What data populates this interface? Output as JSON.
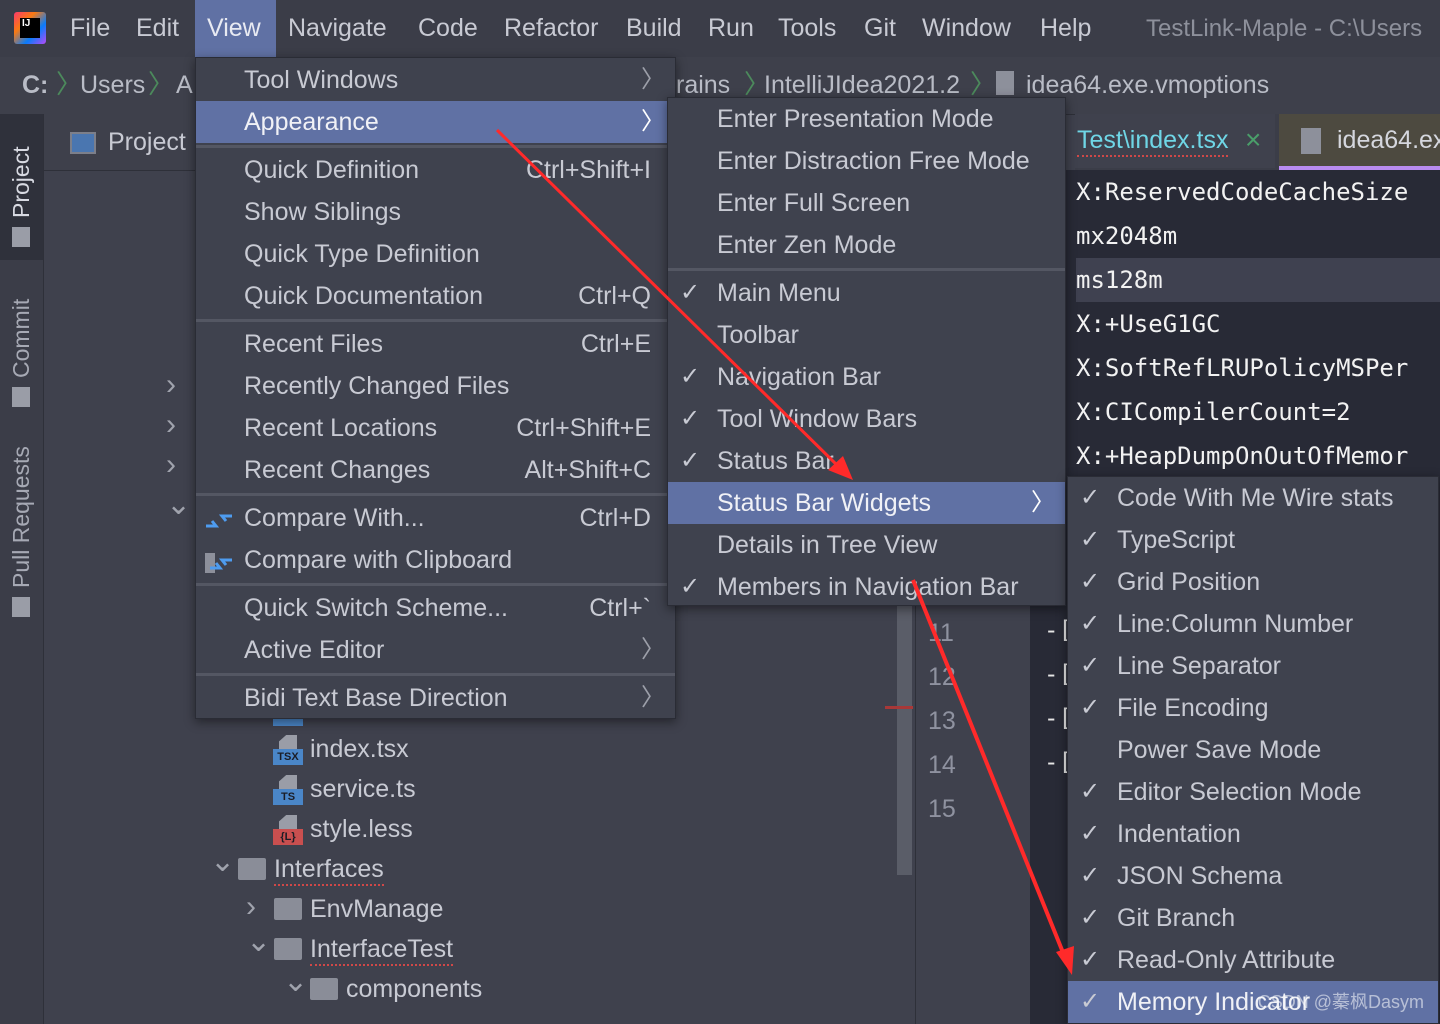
{
  "app": {
    "logo_text": "IJ",
    "title": "TestLink-Maple - C:\\Users"
  },
  "menubar": [
    "File",
    "Edit",
    "View",
    "Navigate",
    "Code",
    "Refactor",
    "Build",
    "Run",
    "Tools",
    "Git",
    "Window",
    "Help"
  ],
  "menubar_active": "View",
  "breadcrumb": [
    "C:",
    "Users",
    "A",
    "rains",
    "IntelliJIdea2021.2",
    "idea64.exe.vmoptions"
  ],
  "tool_strip": [
    {
      "label": "Project",
      "icon": "folder-icon",
      "active": true
    },
    {
      "label": "Commit",
      "icon": "commit-icon"
    },
    {
      "label": "Pull Requests",
      "icon": "pull-request-icon"
    }
  ],
  "project_panel": {
    "title": "Project"
  },
  "tree": [
    {
      "label": "index.tsx",
      "type": "file",
      "badge": "TSX",
      "badge_color": "#4a86c8"
    },
    {
      "label": "service.ts",
      "type": "file",
      "badge": "TS",
      "badge_color": "#4a86c8"
    },
    {
      "label": "style.less",
      "type": "file",
      "badge": "{L}",
      "badge_color": "#c94f4f"
    },
    {
      "label": "Interfaces",
      "type": "folder",
      "expanded": true
    },
    {
      "label": "EnvManage",
      "type": "folder",
      "expanded": false
    },
    {
      "label": "InterfaceTest",
      "type": "folder",
      "expanded": true
    },
    {
      "label": "components",
      "type": "folder",
      "expanded": true
    }
  ],
  "editor": {
    "tabs": [
      {
        "label": "Test\\index.tsx",
        "active": false,
        "close": "×"
      },
      {
        "label": "idea64.ex",
        "active": true
      }
    ],
    "lines": [
      "X:ReservedCodeCacheSize",
      "mx2048m",
      "ms128m",
      "X:+UseG1GC",
      "X:SoftRefLRUPolicyMSPer",
      "X:CICompilerCount=2",
      "X:+HeapDumpOnOutOfMemor"
    ],
    "highlighted_line": 2,
    "line_numbers": [
      "11",
      "12",
      "13",
      "14",
      "15"
    ],
    "fold_marker": "-["
  },
  "view_menu": [
    {
      "label": "Tool Windows",
      "submenu": true
    },
    {
      "label": "Appearance",
      "submenu": true,
      "selected": true
    },
    {
      "sep": true
    },
    {
      "label": "Quick Definition",
      "shortcut": "Ctrl+Shift+I"
    },
    {
      "label": "Show Siblings"
    },
    {
      "label": "Quick Type Definition"
    },
    {
      "label": "Quick Documentation",
      "shortcut": "Ctrl+Q"
    },
    {
      "sep": true
    },
    {
      "label": "Recent Files",
      "shortcut": "Ctrl+E"
    },
    {
      "label": "Recently Changed Files"
    },
    {
      "label": "Recent Locations",
      "shortcut": "Ctrl+Shift+E"
    },
    {
      "label": "Recent Changes",
      "shortcut": "Alt+Shift+C"
    },
    {
      "sep": true
    },
    {
      "label": "Compare With...",
      "shortcut": "Ctrl+D",
      "icon": "compare-icon"
    },
    {
      "label": "Compare with Clipboard",
      "icon": "compare-clipboard-icon"
    },
    {
      "sep": true
    },
    {
      "label": "Quick Switch Scheme...",
      "shortcut": "Ctrl+`"
    },
    {
      "label": "Active Editor",
      "submenu": true
    },
    {
      "sep": true
    },
    {
      "label": "Bidi Text Base Direction",
      "submenu": true
    }
  ],
  "appearance_menu": [
    {
      "label": "Enter Presentation Mode"
    },
    {
      "label": "Enter Distraction Free Mode"
    },
    {
      "label": "Enter Full Screen"
    },
    {
      "label": "Enter Zen Mode"
    },
    {
      "sep": true
    },
    {
      "label": "Main Menu",
      "checked": true
    },
    {
      "label": "Toolbar",
      "checked": false
    },
    {
      "label": "Navigation Bar",
      "checked": true
    },
    {
      "label": "Tool Window Bars",
      "checked": true
    },
    {
      "label": "Status Bar",
      "checked": true
    },
    {
      "label": "Status Bar Widgets",
      "submenu": true,
      "selected": true
    },
    {
      "label": "Details in Tree View",
      "checked": false
    },
    {
      "label": "Members in Navigation Bar",
      "checked": true
    }
  ],
  "widgets_menu": [
    {
      "label": "Code With Me Wire stats",
      "checked": true
    },
    {
      "label": "TypeScript",
      "checked": true
    },
    {
      "label": "Grid Position",
      "checked": true
    },
    {
      "label": "Line:Column Number",
      "checked": true
    },
    {
      "label": "Line Separator",
      "checked": true
    },
    {
      "label": "File Encoding",
      "checked": true
    },
    {
      "label": "Power Save Mode",
      "checked": false
    },
    {
      "label": "Editor Selection Mode",
      "checked": true
    },
    {
      "label": "Indentation",
      "checked": true
    },
    {
      "label": "JSON Schema",
      "checked": true
    },
    {
      "label": "Git Branch",
      "checked": true
    },
    {
      "label": "Read-Only Attribute",
      "checked": true
    },
    {
      "label": "Memory Indicator",
      "checked": true,
      "selected": true
    }
  ],
  "check_glyph": "✓",
  "arrow_glyph": "〉",
  "annotation_color": "#ff2a2a",
  "watermark": "CSDN @蓁枫Dasym"
}
